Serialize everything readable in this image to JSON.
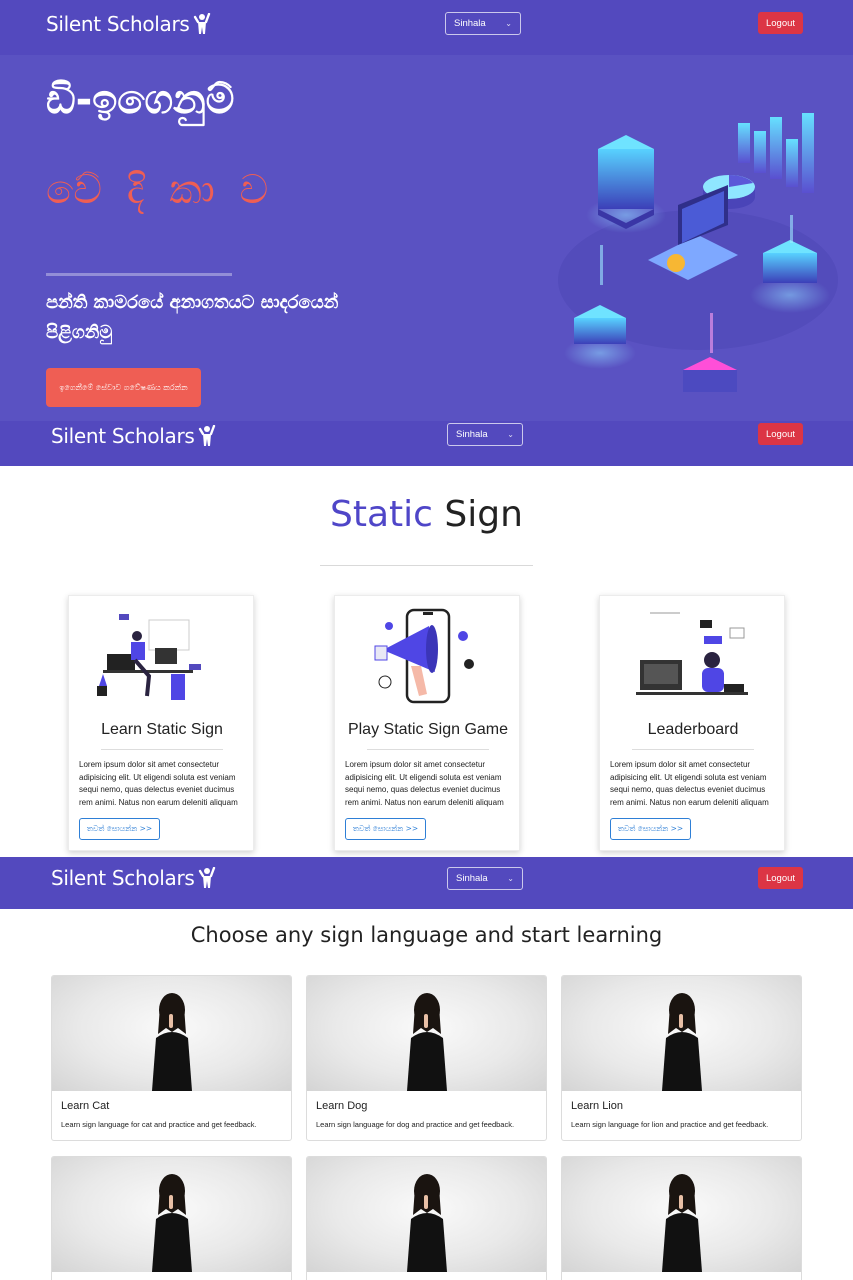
{
  "brand": {
    "name": "Silent Scholars",
    "logo_icon": "person-raising-hand-icon"
  },
  "navbar": {
    "language_value": "Sinhala",
    "logout_label": "Logout"
  },
  "hero": {
    "title": "ඩි-ඉගෙනුම්",
    "subtitle_word": "වේ දි කා ව",
    "tagline": "පන්ති කාමරයේ අනාගතයට සාදරයෙන් පිළිගනිමු",
    "cta_label": "ඉගෙනීමේ සේවාව ගවේෂණය කරන්න"
  },
  "static_sign": {
    "title_accent": "Static",
    "title_rest": "Sign",
    "cards": [
      {
        "title": "Learn Static Sign",
        "text": "Lorem ipsum dolor sit amet consectetur adipisicing elit. Ut eligendi soluta est veniam sequi nemo, quas delectus eveniet ducimus rem animi. Natus non earum deleniti aliquam",
        "button": "තවත් සොයන්න >>"
      },
      {
        "title": "Play Static Sign Game",
        "text": "Lorem ipsum dolor sit amet consectetur adipisicing elit. Ut eligendi soluta est veniam sequi nemo, quas delectus eveniet ducimus rem animi. Natus non earum deleniti aliquam",
        "button": "තවත් සොයන්න >>"
      },
      {
        "title": "Leaderboard",
        "text": "Lorem ipsum dolor sit amet consectetur adipisicing elit. Ut eligendi soluta est veniam sequi nemo, quas delectus eveniet ducimus rem animi. Natus non earum deleniti aliquam",
        "button": "තවත් සොයන්න >>"
      }
    ]
  },
  "learn": {
    "heading": "Choose any sign language and start learning",
    "cards": [
      {
        "title": "Learn Cat",
        "desc": "Learn sign language for cat and practice and get feedback."
      },
      {
        "title": "Learn Dog",
        "desc": "Learn sign language for dog and practice and get feedback."
      },
      {
        "title": "Learn Lion",
        "desc": "Learn sign language for lion and practice and get feedback."
      },
      {
        "title": "",
        "desc": ""
      },
      {
        "title": "",
        "desc": ""
      },
      {
        "title": "",
        "desc": ""
      }
    ]
  },
  "colors": {
    "nav": "#5349be",
    "hero": "#5a52c2",
    "accent_red": "#ef5e54",
    "logout": "#dc3545",
    "link_blue": "#2e7fd6",
    "title_accent": "#4f46c8"
  }
}
